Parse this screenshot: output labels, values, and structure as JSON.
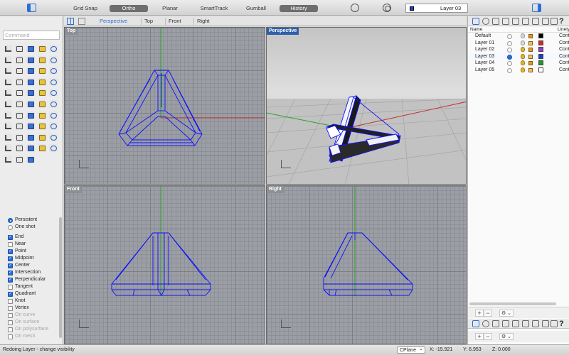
{
  "toolbar": {
    "toggles": [
      {
        "label": "Grid Snap",
        "on": false
      },
      {
        "label": "Ortho",
        "on": true
      },
      {
        "label": "Planar",
        "on": false
      },
      {
        "label": "SmartTrack",
        "on": false
      },
      {
        "label": "Gumball",
        "on": false
      },
      {
        "label": "History",
        "on": true
      }
    ],
    "current_layer": "Layer 03",
    "current_layer_color": "#1a3fd0"
  },
  "command": {
    "placeholder": "Command"
  },
  "tools": {
    "icons": [
      "select-arrow",
      "point",
      "polyline",
      "curve",
      "extend",
      "rect",
      "circle",
      "arc",
      "ellipse",
      "polygon",
      "box-solid",
      "sphere",
      "cylinder",
      "cone",
      "torus",
      "surface-patch",
      "extrude",
      "loft",
      "revolve",
      "sweep",
      "boolean-union",
      "boolean-diff",
      "fillet",
      "chamfer",
      "offset",
      "move",
      "rotate",
      "scale",
      "mirror",
      "array",
      "group",
      "ungroup",
      "join",
      "explode",
      "trim",
      "split",
      "layer",
      "properties",
      "dimension",
      "text",
      "grid",
      "analyze",
      "render",
      "material",
      "light",
      "camera",
      "named-view",
      "color-wheel",
      "environment",
      "zoom",
      "sphere-render",
      "gumball",
      "transform"
    ]
  },
  "osnap": {
    "modes": [
      {
        "label": "Persistent",
        "checked": true
      },
      {
        "label": "One shot",
        "checked": false
      }
    ],
    "items": [
      {
        "label": "End",
        "checked": true,
        "enabled": true
      },
      {
        "label": "Near",
        "checked": false,
        "enabled": true
      },
      {
        "label": "Point",
        "checked": true,
        "enabled": true
      },
      {
        "label": "Midpoint",
        "checked": true,
        "enabled": true
      },
      {
        "label": "Center",
        "checked": true,
        "enabled": true
      },
      {
        "label": "Intersection",
        "checked": true,
        "enabled": true
      },
      {
        "label": "Perpendicular",
        "checked": true,
        "enabled": true
      },
      {
        "label": "Tangent",
        "checked": false,
        "enabled": true
      },
      {
        "label": "Quadrant",
        "checked": true,
        "enabled": true
      },
      {
        "label": "Knot",
        "checked": false,
        "enabled": true
      },
      {
        "label": "Vertex",
        "checked": false,
        "enabled": true
      },
      {
        "label": "On curve",
        "checked": false,
        "enabled": false
      },
      {
        "label": "On surface",
        "checked": false,
        "enabled": false
      },
      {
        "label": "On polysurface",
        "checked": false,
        "enabled": false
      },
      {
        "label": "On mesh",
        "checked": false,
        "enabled": false
      }
    ]
  },
  "viewport_tabs": [
    "Perspective",
    "Top",
    "Front",
    "Right"
  ],
  "viewports": {
    "top": "Top",
    "perspective": "Perspective",
    "front": "Front",
    "right": "Right"
  },
  "layers_panel": {
    "help": "?",
    "columns": {
      "name": "Name",
      "linetype": "Linety"
    },
    "layers": [
      {
        "name": "Default",
        "current": false,
        "visible": false,
        "color": "#000000",
        "linetype": "Cont"
      },
      {
        "name": "Layer 01",
        "current": false,
        "visible": false,
        "color": "#e02020",
        "linetype": "Cont"
      },
      {
        "name": "Layer 02",
        "current": false,
        "visible": true,
        "color": "#9a3ad0",
        "linetype": "Cont"
      },
      {
        "name": "Layer 03",
        "current": true,
        "visible": true,
        "color": "#1a3fd0",
        "linetype": "Cont"
      },
      {
        "name": "Layer 04",
        "current": false,
        "visible": true,
        "color": "#1a9a2a",
        "linetype": "Cont"
      },
      {
        "name": "Layer 05",
        "current": false,
        "visible": true,
        "color": "#ffffff",
        "linetype": "Cont"
      }
    ],
    "add": "+",
    "remove": "−",
    "gear": "⚙ ⌄"
  },
  "status": {
    "message": "Redoing Layer - change visibility",
    "cplane": "CPlane",
    "x": "X: -15.921",
    "y": "Y: 6.953",
    "z": "Z: 0.000"
  },
  "colors": {
    "accent": "#2a6fd6",
    "geometry": "#1010ff",
    "x_axis": "#c0302a",
    "y_axis": "#2aa02a"
  }
}
